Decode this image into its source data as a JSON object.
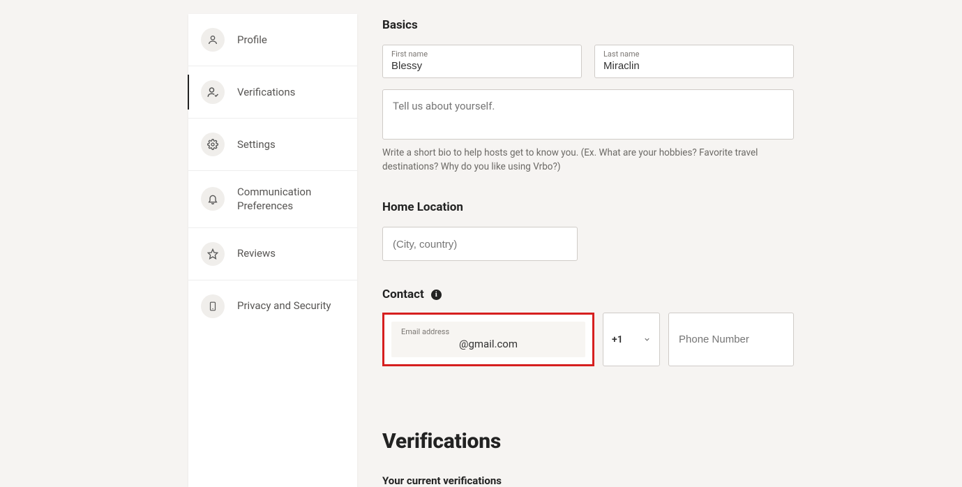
{
  "sidebar": {
    "items": [
      {
        "label": "Profile"
      },
      {
        "label": "Verifications"
      },
      {
        "label": "Settings"
      },
      {
        "label": "Communication Preferences"
      },
      {
        "label": "Reviews"
      },
      {
        "label": "Privacy and Security"
      }
    ]
  },
  "basics": {
    "title": "Basics",
    "first_name_label": "First name",
    "first_name_value": "Blessy",
    "last_name_label": "Last name",
    "last_name_value": "Miraclin",
    "bio_placeholder": "Tell us about yourself.",
    "bio_helper": "Write a short bio to help hosts get to know you. (Ex. What are your hobbies? Favorite travel destinations? Why do you like using Vrbo?)"
  },
  "home_location": {
    "title": "Home Location",
    "placeholder": "(City, country)"
  },
  "contact": {
    "title": "Contact",
    "email_label": "Email address",
    "email_value": "@gmail.com",
    "country_code": "+1",
    "phone_placeholder": "Phone Number"
  },
  "verifications": {
    "heading": "Verifications",
    "current_label": "Your current verifications"
  }
}
